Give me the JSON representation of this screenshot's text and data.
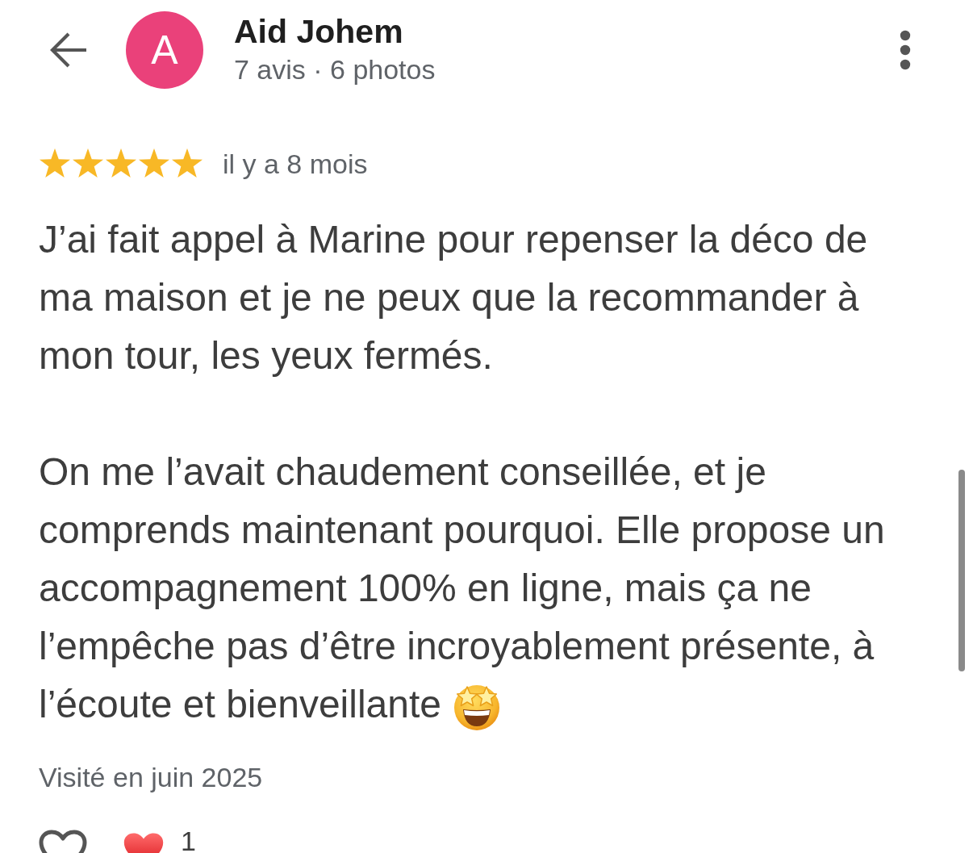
{
  "header": {
    "avatar_letter": "A",
    "name": "Aid Johem",
    "subtitle": "7 avis · 6 photos"
  },
  "review": {
    "stars": 5,
    "time": "il y a 8 mois",
    "paragraphs": [
      "J’ai fait appel à Marine pour repenser la déco de ma maison et je ne peux que la recommander à mon tour, les yeux fermés.",
      "On me l’avait chaudement conseillée, et je comprends maintenant pourquoi. Elle propose un accompagnement 100% en ligne, mais ça ne l’empêche pas d’être incroyablement présente, à l’écoute et bienveillante"
    ],
    "visit": "Visité en juin 2025"
  },
  "reactions": {
    "count": "1"
  }
}
